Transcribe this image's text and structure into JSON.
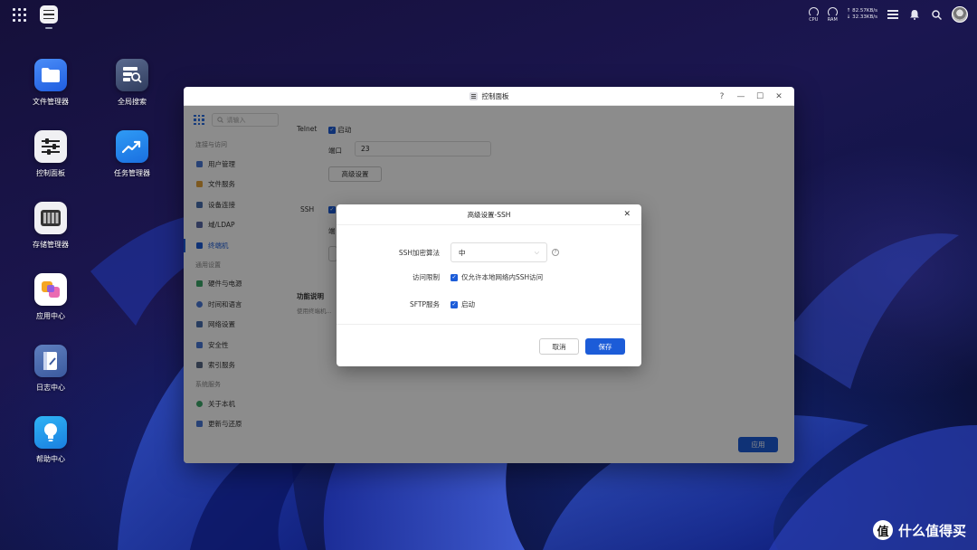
{
  "topbar": {
    "cpu_label": "CPU",
    "ram_label": "RAM",
    "upload_speed": "↑ 82.57KB/s",
    "download_speed": "↓ 32.33KB/s"
  },
  "desktop": {
    "icons": [
      {
        "label": "文件管理器"
      },
      {
        "label": "全局搜索"
      },
      {
        "label": "控制面板"
      },
      {
        "label": "任务管理器"
      },
      {
        "label": "存储管理器"
      },
      {
        "label": "应用中心"
      },
      {
        "label": "日志中心"
      },
      {
        "label": "帮助中心"
      }
    ]
  },
  "window": {
    "title": "控制面板",
    "controls": {
      "help": "?",
      "minimize": "—",
      "maximize": "☐",
      "close": "✕"
    },
    "search_placeholder": "请输入",
    "groups": [
      "连接与访问",
      "通用设置",
      "系统服务"
    ],
    "sidebar_items": [
      {
        "label": "用户管理",
        "color": "#4a78d8"
      },
      {
        "label": "文件服务",
        "color": "#e3a33b"
      },
      {
        "label": "设备连接",
        "color": "#4a6fb0"
      },
      {
        "label": "域/LDAP",
        "color": "#5a6aa8"
      },
      {
        "label": "终端机",
        "color": "#1c5cd8"
      },
      {
        "label": "硬件与电源",
        "color": "#3da86a"
      },
      {
        "label": "时间和语言",
        "color": "#4a78d8"
      },
      {
        "label": "网络设置",
        "color": "#4a6fb0"
      },
      {
        "label": "安全性",
        "color": "#4a78d8"
      },
      {
        "label": "索引服务",
        "color": "#5a6a88"
      },
      {
        "label": "关于本机",
        "color": "#3da86a"
      },
      {
        "label": "更新与还原",
        "color": "#4a78d8"
      }
    ],
    "content": {
      "telnet_label": "Telnet",
      "telnet_enable": "启动",
      "port_label": "端口",
      "port_value": "23",
      "advanced_button": "高级设置",
      "ssh_label": "SSH",
      "ssh_port_label_partial": "端",
      "func_desc_title": "功能说明",
      "func_desc_text": "使用终端机...",
      "apply_button": "应用"
    }
  },
  "modal": {
    "title": "高级设置-SSH",
    "close": "✕",
    "encryption_label": "SSH加密算法",
    "encryption_value": "中",
    "access_label": "访问限制",
    "access_option": "仅允许本地网络内SSH访问",
    "sftp_label": "SFTP服务",
    "sftp_option": "启动",
    "cancel_button": "取消",
    "save_button": "保存"
  },
  "watermark": {
    "badge": "值",
    "text": "什么值得买"
  }
}
